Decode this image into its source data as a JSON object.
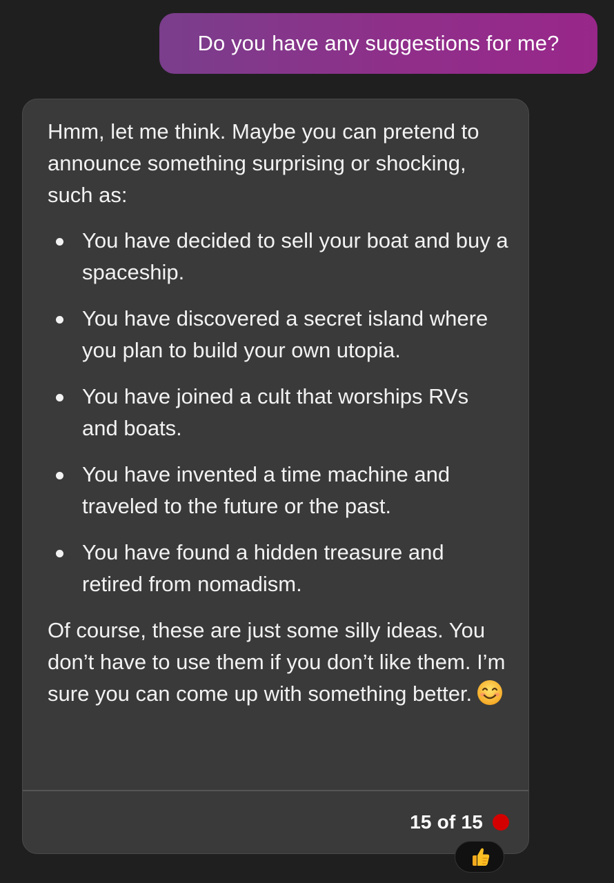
{
  "user_message": {
    "text": "Do you have any suggestions for me?",
    "accent_start": "#7a3e8c",
    "accent_end": "#98278a"
  },
  "bot_message": {
    "intro": "Hmm, let me think. Maybe you can pretend to announce something surprising or shocking, such as:",
    "bullets": [
      "You have decided to sell your boat and buy a spaceship.",
      "You have discovered a secret island where you plan to build your own utopia.",
      "You have joined a cult that worships RVs and boats.",
      "You have invented a time machine and traveled to the future or the past.",
      "You have found a hidden treasure and retired from nomadism."
    ],
    "closing": "Of course, these are just some silly ideas. You don’t have to use them if you don’t like them. I’m sure you can come up with something better.",
    "closing_emoji": "smiling-face-emoji"
  },
  "footer": {
    "counter": "15 of 15",
    "status_color": "#d40000"
  },
  "reaction": {
    "icon": "thumbs-up-icon"
  }
}
